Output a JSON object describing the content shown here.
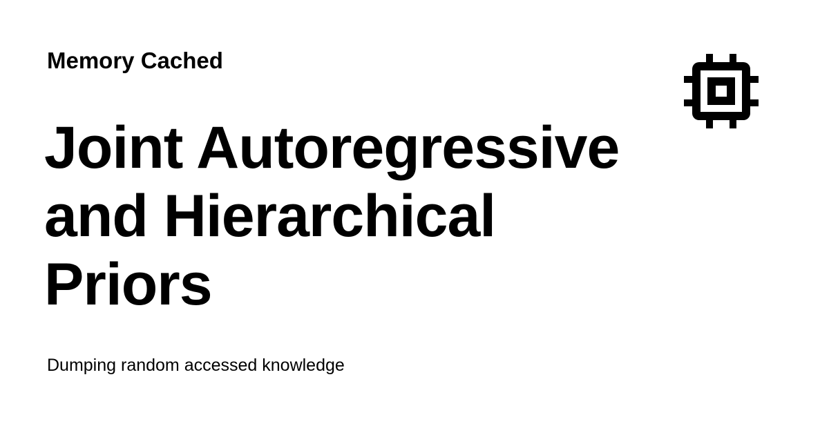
{
  "site": {
    "name": "Memory Cached"
  },
  "post": {
    "title": "Joint Autoregressive and Hierarchical Priors"
  },
  "tagline": "Dumping random accessed knowledge",
  "icon": {
    "name": "chip-icon",
    "color": "#000000"
  }
}
